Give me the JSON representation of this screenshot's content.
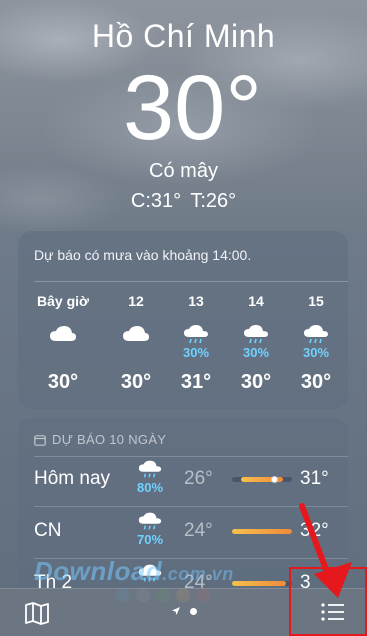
{
  "header": {
    "city": "Hồ Chí Minh",
    "temperature": "30°",
    "condition": "Có mây",
    "high_low": "C:31° T:26°"
  },
  "hourly": {
    "summary": "Dự báo có mưa vào khoảng 14:00.",
    "items": [
      {
        "label": "Bây giờ",
        "icon": "cloud-icon",
        "precip": "",
        "temp": "30°"
      },
      {
        "label": "12",
        "icon": "cloud-icon",
        "precip": "",
        "temp": "30°"
      },
      {
        "label": "13",
        "icon": "cloud-rain-icon",
        "precip": "30%",
        "temp": "31°"
      },
      {
        "label": "14",
        "icon": "cloud-rain-icon",
        "precip": "30%",
        "temp": "30°"
      },
      {
        "label": "15",
        "icon": "cloud-rain-icon",
        "precip": "30%",
        "temp": "30°"
      }
    ]
  },
  "daily": {
    "title": "DỰ BÁO 10 NGÀY",
    "days": [
      {
        "name": "Hôm nay",
        "icon": "cloud-rain-icon",
        "precip": "80%",
        "low": "26°",
        "high": "31°",
        "range_start": 0.15,
        "range_end": 0.85,
        "current": 0.7
      },
      {
        "name": "CN",
        "icon": "cloud-rain-icon",
        "precip": "70%",
        "low": "24°",
        "high": "32°",
        "range_start": 0.0,
        "range_end": 1.0
      },
      {
        "name": "Th 2",
        "icon": "cloud-rain-icon",
        "precip": "",
        "low": "24°",
        "high": "3",
        "range_start": 0.0,
        "range_end": 0.9
      }
    ]
  },
  "watermark": {
    "text": "Download",
    "suffix": ".com.vn"
  },
  "bottom_bar": {
    "map_icon": "map-icon",
    "location_icon": "location-arrow-icon",
    "list_icon": "list-icon"
  },
  "colors": {
    "precip": "#6fd2ff",
    "highlight": "#e5191d",
    "bar_start": "#f6c04b",
    "bar_end": "#f08a3a"
  }
}
